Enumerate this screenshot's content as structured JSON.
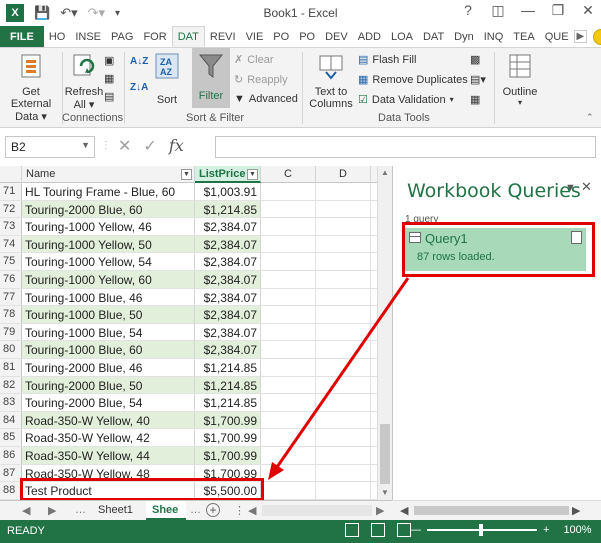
{
  "app": {
    "window_title": "Book1 - Excel",
    "logo_text": "X"
  },
  "tabs": [
    "FILE",
    "HO",
    "INSE",
    "PAG",
    "FOR",
    "DAT",
    "REVI",
    "VIE",
    "PO",
    "PO",
    "DEV",
    "ADD",
    "LOA",
    "DAT",
    "Dyn",
    "INQ",
    "TEA",
    "QUE"
  ],
  "active_tab_index": 5,
  "ribbon": {
    "get_external_label": "Get External Data",
    "get_external_l1": "Get External",
    "get_external_l2": "Data",
    "refresh_l1": "Refresh",
    "refresh_l2": "All",
    "connections_group": "Connections",
    "sort_label": "Sort",
    "filter_label": "Filter",
    "clear_label": "Clear",
    "reapply_label": "Reapply",
    "advanced_label": "Advanced",
    "sort_filter_group": "Sort & Filter",
    "text_to_columns_l1": "Text to",
    "text_to_columns_l2": "Columns",
    "flash_fill_label": "Flash Fill",
    "remove_duplicates_label": "Remove Duplicates",
    "data_validation_label": "Data Validation",
    "data_tools_group": "Data Tools",
    "outline_label": "Outline"
  },
  "formula_bar": {
    "name_box": "B2",
    "fx": "fx",
    "value": ""
  },
  "grid": {
    "headers": {
      "name": "Name",
      "list_price": "ListPrice",
      "c": "C",
      "d": "D"
    },
    "rows": [
      {
        "n": "71",
        "name": "HL Touring Frame - Blue, 60",
        "price": "$1,003.91"
      },
      {
        "n": "72",
        "name": "Touring-2000 Blue, 60",
        "price": "$1,214.85"
      },
      {
        "n": "73",
        "name": "Touring-1000 Yellow, 46",
        "price": "$2,384.07"
      },
      {
        "n": "74",
        "name": "Touring-1000 Yellow, 50",
        "price": "$2,384.07"
      },
      {
        "n": "75",
        "name": "Touring-1000 Yellow, 54",
        "price": "$2,384.07"
      },
      {
        "n": "76",
        "name": "Touring-1000 Yellow, 60",
        "price": "$2,384.07"
      },
      {
        "n": "77",
        "name": "Touring-1000 Blue, 46",
        "price": "$2,384.07"
      },
      {
        "n": "78",
        "name": "Touring-1000 Blue, 50",
        "price": "$2,384.07"
      },
      {
        "n": "79",
        "name": "Touring-1000 Blue, 54",
        "price": "$2,384.07"
      },
      {
        "n": "80",
        "name": "Touring-1000 Blue, 60",
        "price": "$2,384.07"
      },
      {
        "n": "81",
        "name": "Touring-2000 Blue, 46",
        "price": "$1,214.85"
      },
      {
        "n": "82",
        "name": "Touring-2000 Blue, 50",
        "price": "$1,214.85"
      },
      {
        "n": "83",
        "name": "Touring-2000 Blue, 54",
        "price": "$1,214.85"
      },
      {
        "n": "84",
        "name": "Road-350-W Yellow, 40",
        "price": "$1,700.99"
      },
      {
        "n": "85",
        "name": "Road-350-W Yellow, 42",
        "price": "$1,700.99"
      },
      {
        "n": "86",
        "name": "Road-350-W Yellow, 44",
        "price": "$1,700.99"
      },
      {
        "n": "87",
        "name": "Road-350-W Yellow, 48",
        "price": "$1,700.99"
      },
      {
        "n": "88",
        "name": "Test Product",
        "price": "$5,500.00"
      }
    ]
  },
  "sheets": {
    "tab1": "Sheet1",
    "tab2": "Shee"
  },
  "queries_pane": {
    "title": "Workbook Queries",
    "count": "1 query",
    "item_name": "Query1",
    "item_status": "87 rows loaded."
  },
  "status": {
    "ready": "READY",
    "zoom": "100%"
  },
  "colors": {
    "excel_green": "#217346",
    "band_green": "#e2efda",
    "query_item_bg": "#a8d9b9",
    "highlight_red": "#e00000"
  }
}
